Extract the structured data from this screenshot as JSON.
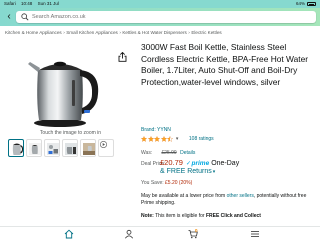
{
  "status_bar": {
    "carrier": "Safari",
    "time": "10:48",
    "date": "Sun 31 Jul",
    "battery": "64%"
  },
  "search": {
    "placeholder": "Search Amazon.co.uk"
  },
  "breadcrumb": [
    "Kitchen & Home Appliances",
    "Small Kitchen Appliances",
    "Kettles & Hot Water Dispensers",
    "Electric Kettles"
  ],
  "breadcrumb_separator": "›",
  "gallery": {
    "zoom_hint": "Touch the image to zoom in",
    "thumbnail_count": 6,
    "selected_index": 0
  },
  "product": {
    "title": "3000W Fast Boil Kettle, Stainless Steel Cordless Electric Kettle, BPA-Free Hot Water Boiler, 1.7Liter, Auto Shut-Off and Boil-Dry Protection,water-level windows, silver",
    "brand_label": "Brand: YYNN",
    "rating_stars": 4.5,
    "rating_count": "108 ratings"
  },
  "pricing": {
    "was_label": "Was:",
    "was_price": "£25.99",
    "details_link": "Details",
    "deal_label": "Deal Price:",
    "deal_price": "£20.79",
    "prime_label": "prime",
    "one_day": "One-Day",
    "returns": "& FREE Returns",
    "save_label": "You Save:",
    "save_value": "£5.20 (20%)"
  },
  "lower_price": {
    "text_before": "May be available at a lower price from ",
    "link": "other sellers",
    "text_after": ", potentially without free Prime shipping."
  },
  "note": {
    "label": "Note:",
    "text": " This item is eligible for ",
    "bold": "FREE Click and Collect"
  },
  "bottom_nav": {
    "items": [
      "home-icon",
      "account-icon",
      "cart-icon",
      "menu-icon"
    ],
    "cart_count": "0"
  },
  "colors": {
    "header_start": "#86d9cf",
    "header_end": "#a5e6ba",
    "link": "#007185",
    "price": "#b12704",
    "star": "#ffa41c",
    "prime": "#00a8e1"
  }
}
